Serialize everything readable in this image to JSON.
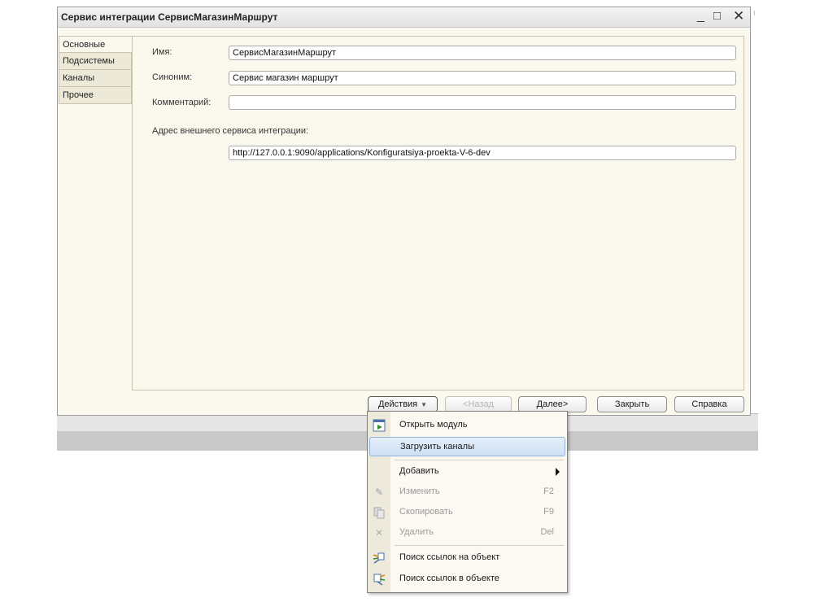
{
  "window": {
    "title": "Сервис интеграции СервисМагазинМаршрут",
    "min_glyph": "_",
    "max_glyph": "□",
    "close_glyph": "✕"
  },
  "tabs": [
    {
      "label": "Основные",
      "active": true
    },
    {
      "label": "Подсистемы",
      "active": false
    },
    {
      "label": "Каналы",
      "active": false
    },
    {
      "label": "Прочее",
      "active": false
    }
  ],
  "form": {
    "name_label": "Имя:",
    "name_value": "СервисМагазинМаршрут",
    "synonym_label": "Синоним:",
    "synonym_value": "Сервис магазин маршрут",
    "comment_label": "Комментарий:",
    "comment_value": "",
    "address_label": "Адрес внешнего сервиса интеграции:",
    "address_value": "http://127.0.0.1:9090/applications/Konfiguratsiya-proekta-V-6-dev"
  },
  "buttons": {
    "actions": "Действия",
    "back": "<Назад",
    "next": "Далее>",
    "close": "Закрыть",
    "help": "Справка"
  },
  "menu": {
    "open_module": "Открыть модуль",
    "load_channels": "Загрузить каналы",
    "add": "Добавить",
    "edit": "Изменить",
    "edit_key": "F2",
    "copy": "Скопировать",
    "copy_key": "F9",
    "delete": "Удалить",
    "delete_key": "Del",
    "find_refs_to": "Поиск ссылок на объект",
    "find_refs_in": "Поиск ссылок в объекте"
  },
  "colors": {
    "window_bg": "#fbf8ee",
    "highlight_bg": "#cfe0f5",
    "highlight_border": "#8fb2dc"
  }
}
